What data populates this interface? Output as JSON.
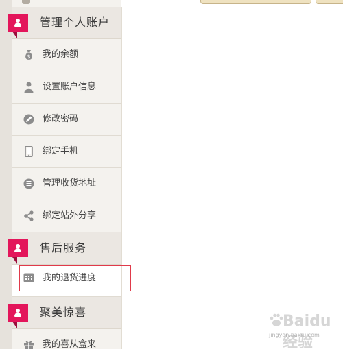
{
  "sections": [
    {
      "title": "管理个人账户",
      "items": [
        {
          "label": "我的余额",
          "icon": "money-bag-icon"
        },
        {
          "label": "设置账户信息",
          "icon": "user-icon"
        },
        {
          "label": "修改密码",
          "icon": "pencil-circle-icon"
        },
        {
          "label": "绑定手机",
          "icon": "phone-icon"
        },
        {
          "label": "管理收货地址",
          "icon": "address-book-icon"
        },
        {
          "label": "绑定站外分享",
          "icon": "share-icon"
        }
      ]
    },
    {
      "title": "售后服务",
      "items": [
        {
          "label": "我的退货进度",
          "icon": "grid-calendar-icon"
        }
      ]
    },
    {
      "title": "聚美惊喜",
      "items": [
        {
          "label": "我的喜从盒来",
          "icon": "gift-icon"
        }
      ]
    }
  ],
  "watermark": {
    "main": "Baidu经验",
    "sub": "jingyan.baidu.com"
  },
  "colors": {
    "accent": "#e3165b",
    "highlight_border": "#e03a4a",
    "icon": "#8c8c8c"
  }
}
